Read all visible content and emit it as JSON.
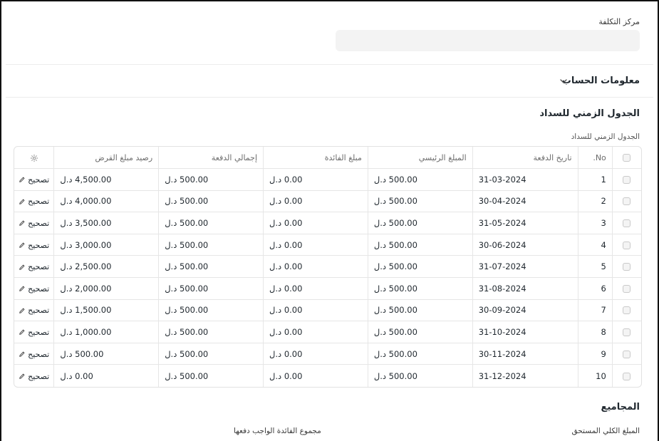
{
  "cost_center": {
    "label": "مركز التكلفة",
    "value": ""
  },
  "account_info": {
    "title": "معلومات الحساب"
  },
  "schedule": {
    "title": "الجدول الزمني للسداد",
    "table_label": "الجدول الزمني للسداد",
    "columns": {
      "no": "No.",
      "date": "تاريخ الدفعة",
      "principal": "المبلغ الرئيسي",
      "interest": "مبلغ الفائدة",
      "total": "إجمالي الدفعة",
      "balance": "رصيد مبلغ القرض"
    },
    "edit_label": "تصحيح",
    "rows": [
      {
        "no": "1",
        "date": "31-03-2024",
        "principal": "500.00 د.ل",
        "interest": "0.00 د.ل",
        "total": "500.00 د.ل",
        "balance": "4,500.00 د.ل"
      },
      {
        "no": "2",
        "date": "30-04-2024",
        "principal": "500.00 د.ل",
        "interest": "0.00 د.ل",
        "total": "500.00 د.ل",
        "balance": "4,000.00 د.ل"
      },
      {
        "no": "3",
        "date": "31-05-2024",
        "principal": "500.00 د.ل",
        "interest": "0.00 د.ل",
        "total": "500.00 د.ل",
        "balance": "3,500.00 د.ل"
      },
      {
        "no": "4",
        "date": "30-06-2024",
        "principal": "500.00 د.ل",
        "interest": "0.00 د.ل",
        "total": "500.00 د.ل",
        "balance": "3,000.00 د.ل"
      },
      {
        "no": "5",
        "date": "31-07-2024",
        "principal": "500.00 د.ل",
        "interest": "0.00 د.ل",
        "total": "500.00 د.ل",
        "balance": "2,500.00 د.ل"
      },
      {
        "no": "6",
        "date": "31-08-2024",
        "principal": "500.00 د.ل",
        "interest": "0.00 د.ل",
        "total": "500.00 د.ل",
        "balance": "2,000.00 د.ل"
      },
      {
        "no": "7",
        "date": "30-09-2024",
        "principal": "500.00 د.ل",
        "interest": "0.00 د.ل",
        "total": "500.00 د.ل",
        "balance": "1,500.00 د.ل"
      },
      {
        "no": "8",
        "date": "31-10-2024",
        "principal": "500.00 د.ل",
        "interest": "0.00 د.ل",
        "total": "500.00 د.ل",
        "balance": "1,000.00 د.ل"
      },
      {
        "no": "9",
        "date": "30-11-2024",
        "principal": "500.00 د.ل",
        "interest": "0.00 د.ل",
        "total": "500.00 د.ل",
        "balance": "500.00 د.ل"
      },
      {
        "no": "10",
        "date": "31-12-2024",
        "principal": "500.00 د.ل",
        "interest": "0.00 د.ل",
        "total": "500.00 د.ل",
        "balance": "0.00 د.ل"
      }
    ]
  },
  "totals": {
    "title": "المجاميع",
    "total_amount_label": "المبلغ الكلي المستحق",
    "total_interest_label": "مجموع الفائدة الواجب دفعها"
  }
}
